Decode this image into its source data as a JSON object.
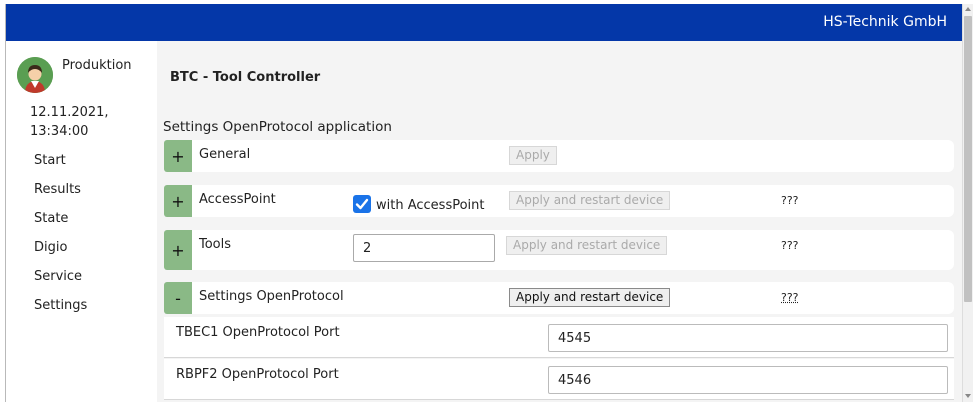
{
  "header": {
    "brand": "HS-Technik GmbH"
  },
  "sidebar": {
    "user": "Produktion",
    "date": "12.11.2021,",
    "time": "13:34:00",
    "nav": [
      "Start",
      "Results",
      "State",
      "Digio",
      "Service",
      "Settings"
    ]
  },
  "main": {
    "app_title": "BTC - Tool Controller",
    "section_title": "Settings OpenProtocol application",
    "panels": [
      {
        "toggle": "+",
        "label": "General",
        "button": "Apply"
      },
      {
        "toggle": "+",
        "label": "AccessPoint",
        "checkbox_label": "with AccessPoint",
        "checkbox_checked": true,
        "button": "Apply and restart device",
        "help": "???"
      },
      {
        "toggle": "+",
        "label": "Tools",
        "value": "2",
        "button": "Apply and restart device",
        "help": "???"
      },
      {
        "toggle": "-",
        "label": "Settings OpenProtocol",
        "button": "Apply and restart device",
        "help": "???"
      }
    ],
    "ports": [
      {
        "label": "TBEC1 OpenProtocol Port",
        "value": "4545"
      },
      {
        "label": "RBPF2 OpenProtocol Port",
        "value": "4546"
      }
    ]
  },
  "colors": {
    "header_bg": "#0437a8",
    "toggle_bg": "#8ab986",
    "checkbox": "#1a73e8"
  }
}
